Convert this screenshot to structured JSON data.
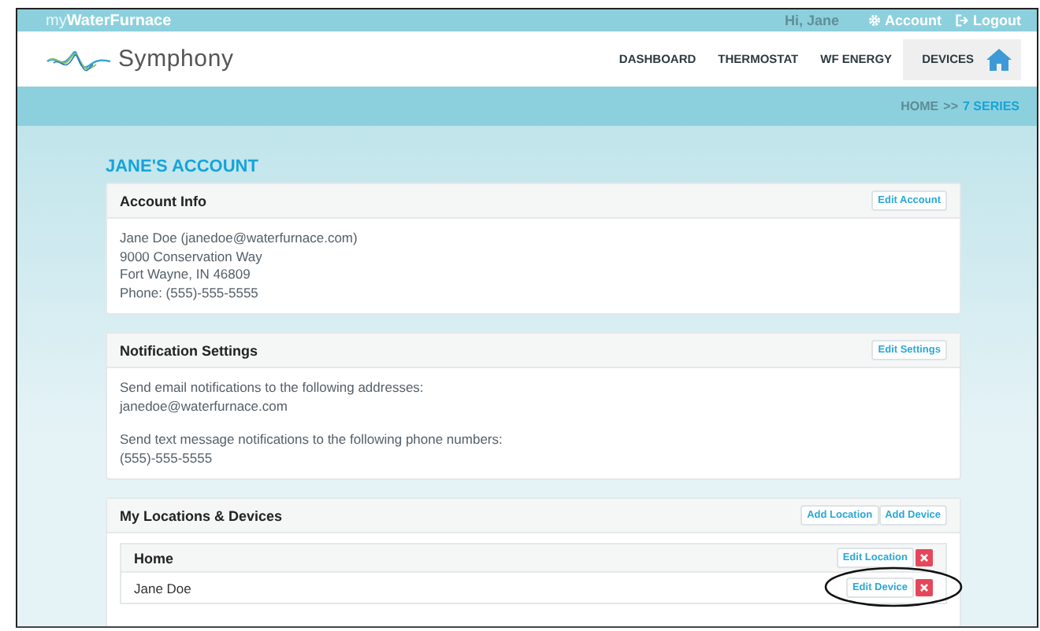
{
  "top_bar": {
    "brand": "my**WaterFurnace**",
    "greeting": "Hi, Jane",
    "links": [
      {
        "label": "Account"
      },
      {
        "label": "Logout"
      }
    ]
  },
  "header": {
    "logo_text": "Symphony",
    "nav": [
      {
        "label": "DASHBOARD",
        "selected": false
      },
      {
        "label": "THERMOSTAT",
        "selected": false
      },
      {
        "label": "WF ENERGY",
        "selected": false
      },
      {
        "label": "DEVICES",
        "selected": true
      }
    ]
  },
  "breadcrumb": {
    "items": [
      {
        "label": "HOME",
        "selected": false
      },
      {
        "label": "7 SERIES",
        "selected": true
      }
    ],
    "separator": ">>"
  },
  "page_title": "JANE'S ACCOUNT",
  "cards": [
    {
      "title": "Account Info",
      "buttons": [
        "Edit Account"
      ],
      "lines": [
        "Jane Doe (janedoe@waterfurnace.com)",
        "9000 Conservation Way",
        "Fort Wayne, IN 46809",
        "Phone: (555)-555-5555"
      ]
    },
    {
      "title": "Notification Settings",
      "buttons": [
        "Edit Settings"
      ],
      "paragraphs": [
        [
          "Send email notifications to the following addresses:",
          "janedoe@waterfurnace.com"
        ],
        [
          "Send text message notifications to the following phone numbers:",
          "(555)-555-5555"
        ]
      ]
    },
    {
      "title": "My Locations & Devices",
      "buttons": [
        "Add Location",
        "Add Device"
      ],
      "locations": [
        {
          "name": "Home",
          "button": "Edit Location",
          "devices": [
            {
              "name": "Jane Doe",
              "button": "Edit Device",
              "circled": true
            }
          ]
        }
      ]
    }
  ]
}
